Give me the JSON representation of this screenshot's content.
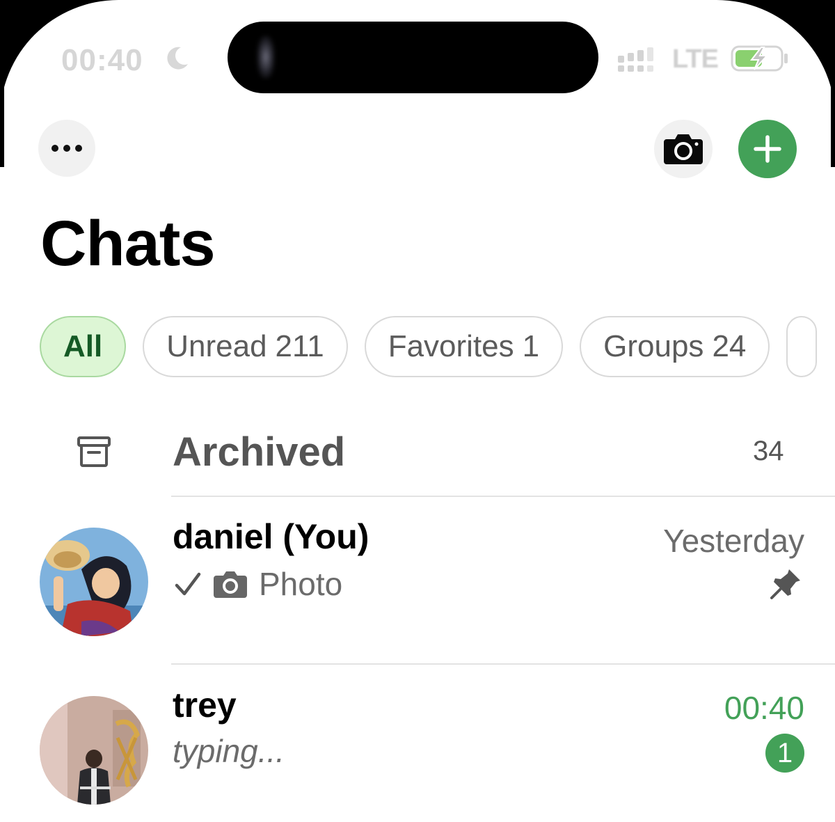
{
  "status_bar": {
    "time": "00:40",
    "network": "LTE"
  },
  "page_title": "Chats",
  "filters": [
    {
      "label": "All",
      "count": ""
    },
    {
      "label": "Unread",
      "count": "211"
    },
    {
      "label": "Favorites",
      "count": "1"
    },
    {
      "label": "Groups",
      "count": "24"
    }
  ],
  "archived": {
    "label": "Archived",
    "count": "34"
  },
  "chats": [
    {
      "name": "daniel (You)",
      "time": "Yesterday",
      "preview": "Photo",
      "pinned": true
    },
    {
      "name": "trey",
      "time": "00:40",
      "preview": "typing...",
      "unread": "1"
    }
  ],
  "icons": {
    "more": "ellipsis-icon",
    "camera": "camera-icon",
    "new_chat": "plus-icon",
    "archive": "archive-box-icon",
    "pin": "pin-icon",
    "read": "checkmark-icon"
  },
  "colors": {
    "accent": "#43a158",
    "chip_active_bg": "#ddf6d5",
    "chip_active_text": "#155a25"
  }
}
